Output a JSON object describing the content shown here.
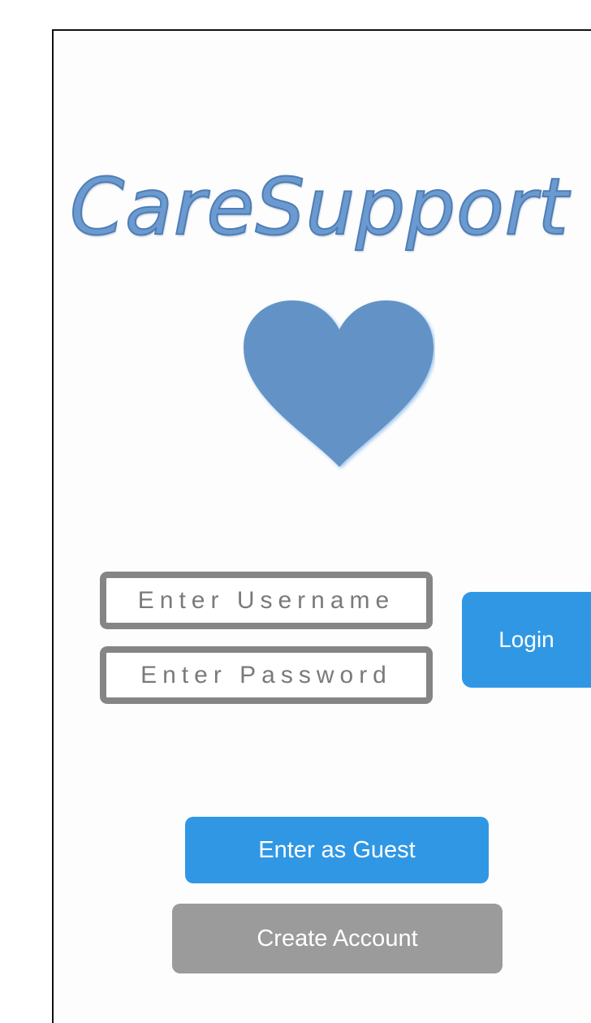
{
  "app": {
    "title": "CareSupport"
  },
  "login_form": {
    "username_placeholder": "Enter Username",
    "password_placeholder": "Enter Password",
    "login_label": "Login"
  },
  "actions": {
    "guest_label": "Enter as Guest",
    "create_account_label": "Create Account"
  },
  "colors": {
    "logo": "#6b9ad0",
    "heart": "#6393c6",
    "primary_button": "#3097e5",
    "secondary_button": "#9b9b9b",
    "field_border": "#858585"
  },
  "icons": {
    "logo_icon": "heart-icon"
  }
}
